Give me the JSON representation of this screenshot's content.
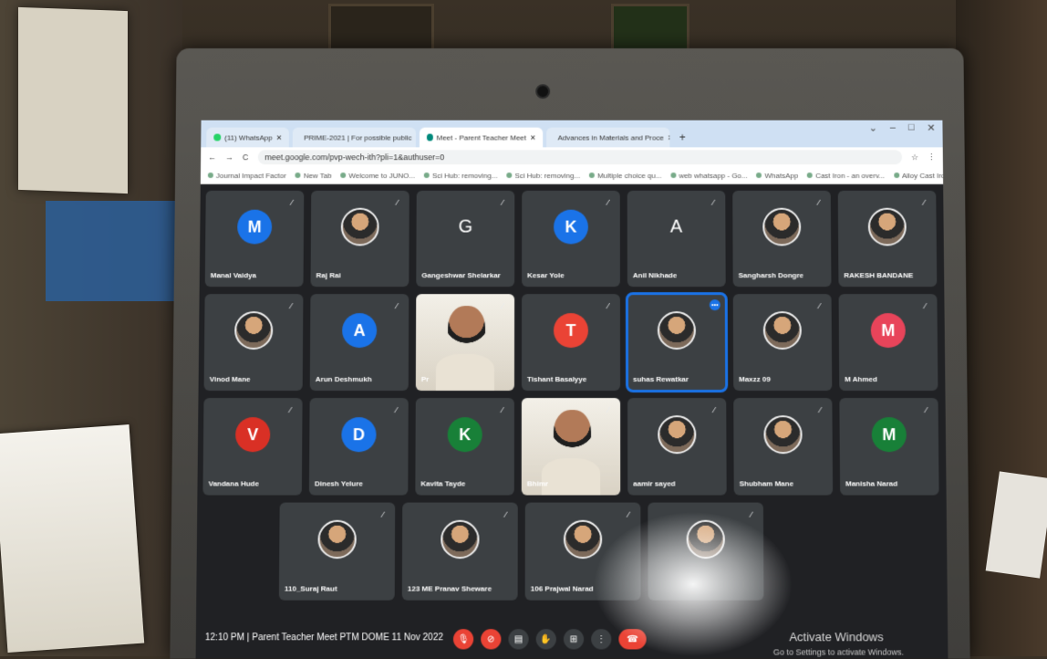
{
  "browser": {
    "tabs": [
      {
        "label": "(11) WhatsApp",
        "color": "#25d366",
        "active": false
      },
      {
        "label": "PRIME-2021 | For possible public",
        "color": "#d93025",
        "active": false
      },
      {
        "label": "Meet - Parent Teacher Meet",
        "color": "#00897b",
        "active": true
      },
      {
        "label": "Advances in Materials and Proce",
        "color": "#1a73e8",
        "active": false
      }
    ],
    "new_tab": "+",
    "window_controls": [
      "⌄",
      "–",
      "□",
      "✕"
    ],
    "url": "meet.google.com/pvp-wech-ith?pli=1&authuser=0",
    "bookmarks": [
      "Journal Impact Factor",
      "New Tab",
      "Welcome to JUNO...",
      "Sci Hub: removing...",
      "Sci Hub: removing...",
      "Multiple choice qu...",
      "web whatsapp - Go...",
      "WhatsApp",
      "Cast Iron - an overv...",
      "Alloy Cast Iron - an..."
    ]
  },
  "meet": {
    "rows": [
      {
        "tiles": [
          {
            "name": "Manal Vaidya",
            "type": "avatar",
            "initial": "M",
            "color": "#1a73e8"
          },
          {
            "name": "Raj Rai",
            "type": "photo"
          },
          {
            "name": "Gangeshwar Shelarkar",
            "type": "letter",
            "initial": "G"
          },
          {
            "name": "Kesar Yole",
            "type": "avatar",
            "initial": "K",
            "color": "#1a73e8"
          },
          {
            "name": "Anil Nikhade",
            "type": "letter",
            "initial": "A"
          },
          {
            "name": "Sangharsh Dongre",
            "type": "photo"
          },
          {
            "name": "RAKESH BANDANE",
            "type": "photo"
          }
        ]
      },
      {
        "tiles": [
          {
            "name": "Vinod Mane",
            "type": "photo"
          },
          {
            "name": "Arun Deshmukh",
            "type": "avatar",
            "initial": "A",
            "color": "#1a73e8"
          },
          {
            "name": "Pr",
            "type": "video"
          },
          {
            "name": "Tishant Basalyye",
            "type": "avatar",
            "initial": "T",
            "color": "#ea4335"
          },
          {
            "name": "suhas Rewatkar",
            "type": "photo",
            "speaking": true
          },
          {
            "name": "Maxzz 09",
            "type": "photo"
          },
          {
            "name": "M Ahmed",
            "type": "avatar",
            "initial": "M",
            "color": "#e8445a"
          }
        ]
      },
      {
        "tiles": [
          {
            "name": "Vandana Hude",
            "type": "avatar",
            "initial": "V",
            "color": "#d93025"
          },
          {
            "name": "Dinesh Yelure",
            "type": "avatar",
            "initial": "D",
            "color": "#1a73e8"
          },
          {
            "name": "Kavita Tayde",
            "type": "avatar",
            "initial": "K",
            "color": "#188038"
          },
          {
            "name": "Bhimr",
            "type": "video"
          },
          {
            "name": "aamir sayed",
            "type": "photo"
          },
          {
            "name": "Shubham Mane",
            "type": "photo"
          },
          {
            "name": "Manisha Narad",
            "type": "avatar",
            "initial": "M",
            "color": "#188038"
          }
        ]
      },
      {
        "tiles": [
          {
            "name": "110_Suraj Raut",
            "type": "photo"
          },
          {
            "name": "123 ME Pranav Sheware",
            "type": "photo"
          },
          {
            "name": "106 Prajwal Narad",
            "type": "photo"
          },
          {
            "name": "",
            "type": "photo"
          }
        ]
      }
    ],
    "footer": {
      "time": "12:10 PM",
      "separator": "|",
      "meeting_title": "Parent Teacher Meet PTM DOME 11 Nov 2022"
    },
    "controls": [
      {
        "icon": "mic-off-icon",
        "glyph": "🎙",
        "color": "red"
      },
      {
        "icon": "camera-off-icon",
        "glyph": "⊘",
        "color": "red"
      },
      {
        "icon": "captions-icon",
        "glyph": "▤",
        "color": "grey"
      },
      {
        "icon": "raise-hand-icon",
        "glyph": "✋",
        "color": "grey"
      },
      {
        "icon": "present-icon",
        "glyph": "⊞",
        "color": "grey"
      },
      {
        "icon": "more-options-icon",
        "glyph": "⋮",
        "color": "grey"
      },
      {
        "icon": "hang-up-icon",
        "glyph": "☎",
        "color": "red"
      }
    ],
    "activate_windows": "Activate Windows",
    "activate_windows_sub": "Go to Settings to activate Windows."
  }
}
